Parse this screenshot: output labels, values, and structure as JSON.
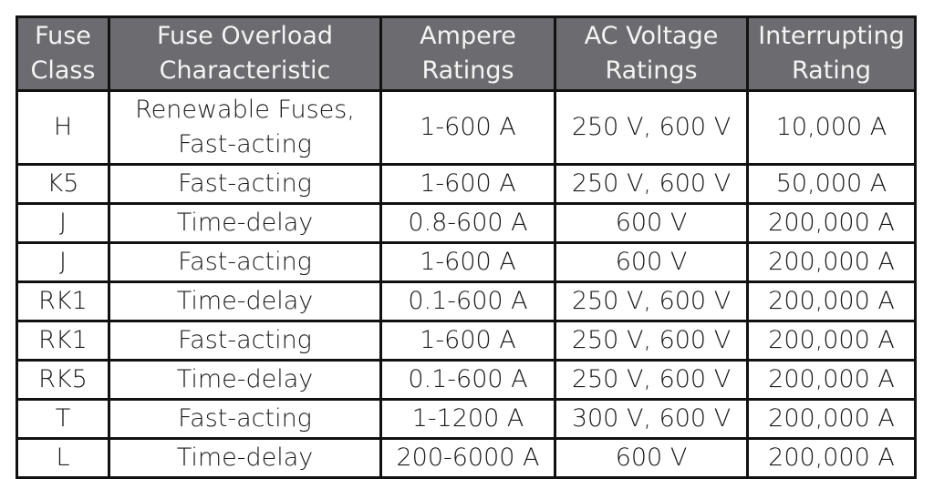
{
  "table": {
    "headers": [
      {
        "line1": "Fuse",
        "line2": "Class"
      },
      {
        "line1": "Fuse Overload",
        "line2": "Characteristic"
      },
      {
        "line1": "Ampere",
        "line2": "Ratings"
      },
      {
        "line1": "AC Voltage",
        "line2": "Ratings"
      },
      {
        "line1": "Interrupting",
        "line2": "Rating"
      }
    ],
    "rows": [
      {
        "fuse_class": "H",
        "characteristic_line1": "Renewable Fuses,",
        "characteristic_line2": "Fast-acting",
        "ampere": "1-600 A",
        "voltage": "250 V, 600 V",
        "interrupting": "10,000 A"
      },
      {
        "fuse_class": "K5",
        "characteristic": "Fast-acting",
        "ampere": "1-600 A",
        "voltage": "250 V, 600 V",
        "interrupting": "50,000 A"
      },
      {
        "fuse_class": "J",
        "characteristic": "Time-delay",
        "ampere": "0.8-600 A",
        "voltage": "600 V",
        "interrupting": "200,000 A"
      },
      {
        "fuse_class": "J",
        "characteristic": "Fast-acting",
        "ampere": "1-600 A",
        "voltage": "600 V",
        "interrupting": "200,000 A"
      },
      {
        "fuse_class": "RK1",
        "characteristic": "Time-delay",
        "ampere": "0.1-600 A",
        "voltage": "250 V, 600 V",
        "interrupting": "200,000 A"
      },
      {
        "fuse_class": "RK1",
        "characteristic": "Fast-acting",
        "ampere": "1-600 A",
        "voltage": "250 V, 600 V",
        "interrupting": "200,000 A"
      },
      {
        "fuse_class": "RK5",
        "characteristic": "Time-delay",
        "ampere": "0.1-600 A",
        "voltage": "250 V, 600 V",
        "interrupting": "200,000 A"
      },
      {
        "fuse_class": "T",
        "characteristic": "Fast-acting",
        "ampere": "1-1200 A",
        "voltage": "300 V, 600 V",
        "interrupting": "200,000 A"
      },
      {
        "fuse_class": "L",
        "characteristic": "Time-delay",
        "ampere": "200-6000 A",
        "voltage": "600 V",
        "interrupting": "200,000 A"
      }
    ]
  },
  "colors": {
    "header_bg": "#6b6b70",
    "header_text": "#f4f4f4",
    "border": "#111111",
    "body_text": "#1a1a1a"
  }
}
